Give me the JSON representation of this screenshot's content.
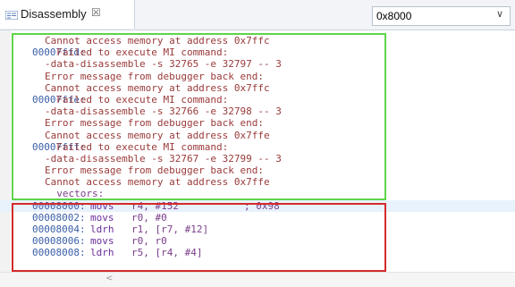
{
  "tab": {
    "label": "Disassembly",
    "icon": "disassembly-icon",
    "close_glyph": "☒"
  },
  "address_box": {
    "value": "0x8000",
    "chevron": "∨"
  },
  "lines": [
    {
      "addr": "",
      "text": "Cannot access memory at address 0x7ffc",
      "kind": "err"
    },
    {
      "addr": "00007ffd:",
      "text": "  Failed to execute MI command:",
      "kind": "err"
    },
    {
      "addr": "",
      "text": "-data-disassemble -s 32765 -e 32797 -- 3",
      "kind": "err"
    },
    {
      "addr": "",
      "text": "Error message from debugger back end:",
      "kind": "err"
    },
    {
      "addr": "",
      "text": "Cannot access memory at address 0x7ffc",
      "kind": "err"
    },
    {
      "addr": "00007ffe:",
      "text": "  Failed to execute MI command:",
      "kind": "err"
    },
    {
      "addr": "",
      "text": "-data-disassemble -s 32766 -e 32798 -- 3",
      "kind": "err"
    },
    {
      "addr": "",
      "text": "Error message from debugger back end:",
      "kind": "err"
    },
    {
      "addr": "",
      "text": "Cannot access memory at address 0x7ffe",
      "kind": "err"
    },
    {
      "addr": "00007fff:",
      "text": "  Failed to execute MI command:",
      "kind": "err"
    },
    {
      "addr": "",
      "text": "-data-disassemble -s 32767 -e 32799 -- 3",
      "kind": "err"
    },
    {
      "addr": "",
      "text": "Error message from debugger back end:",
      "kind": "err"
    },
    {
      "addr": "",
      "text": "Cannot access memory at address 0x7ffe",
      "kind": "err"
    },
    {
      "addr": "",
      "text": "__vectors:",
      "kind": "label"
    },
    {
      "addr": "00008000:",
      "mnemonic": "movs",
      "operands": "r4, #152",
      "comment": "; 0x98",
      "kind": "code",
      "highlight": true
    },
    {
      "addr": "00008002:",
      "mnemonic": "movs",
      "operands": "r0, #0",
      "kind": "code"
    },
    {
      "addr": "00008004:",
      "mnemonic": "ldrh",
      "operands": "r1, [r7, #12]",
      "kind": "code"
    },
    {
      "addr": "00008006:",
      "mnemonic": "movs",
      "operands": "r0, r0",
      "kind": "code"
    },
    {
      "addr": "00008008:",
      "mnemonic": "ldrh",
      "operands": "r5, [r4, #4]",
      "kind": "code"
    }
  ],
  "scrollbar": {
    "left_arrow": "<"
  }
}
